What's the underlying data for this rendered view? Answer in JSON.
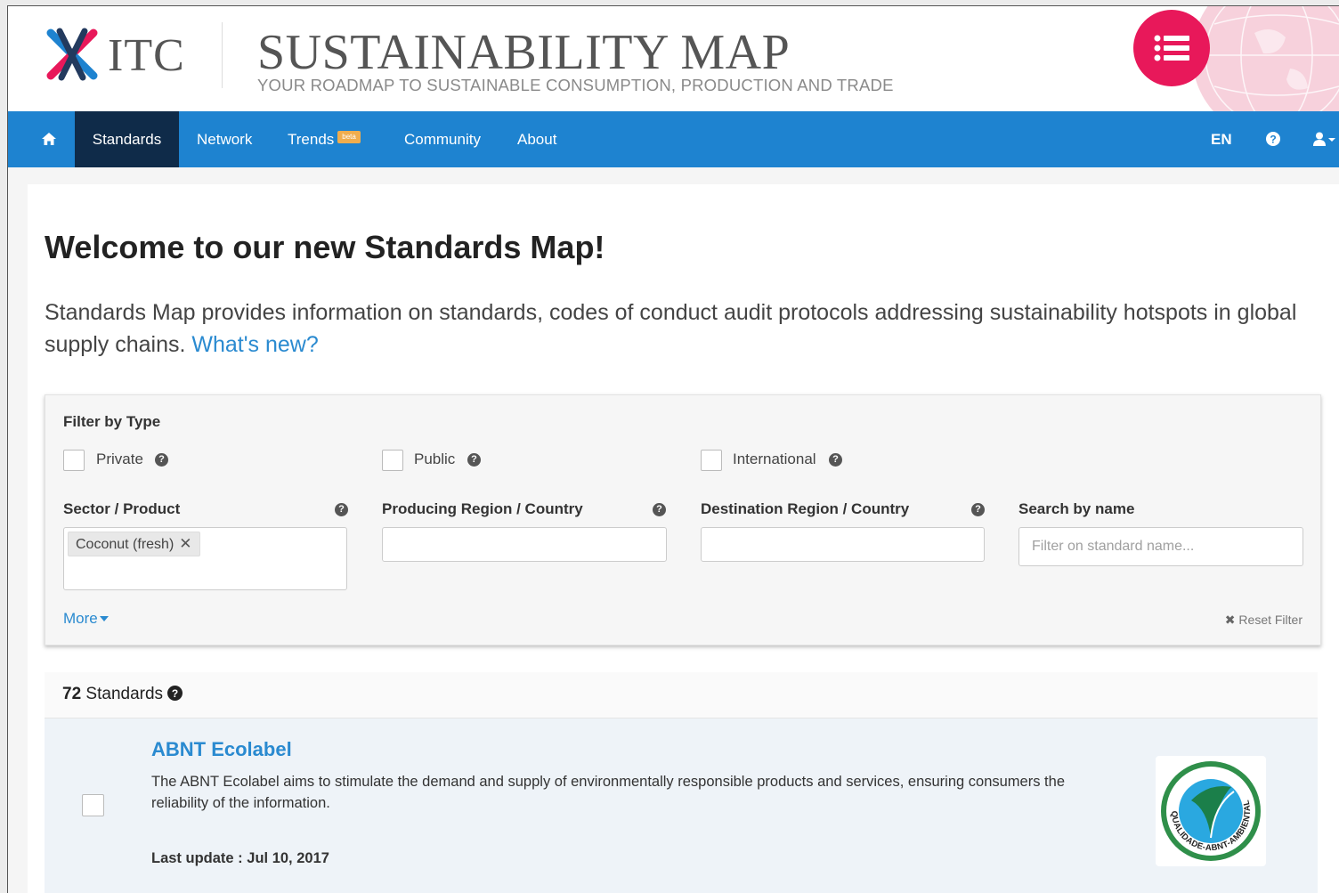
{
  "header": {
    "logo_text": "ITC",
    "title": "SUSTAINABILITY MAP",
    "tagline": "YOUR ROADMAP TO SUSTAINABLE CONSUMPTION, PRODUCTION AND TRADE",
    "menu_icon": "list-icon",
    "colors": {
      "accent": "#e8185a",
      "nav": "#1e83d0",
      "nav_active": "#0f2b49"
    }
  },
  "nav": {
    "home_icon": "home-icon",
    "items": [
      {
        "label": "Standards"
      },
      {
        "label": "Network"
      },
      {
        "label": "Trends",
        "badge": "beta"
      },
      {
        "label": "Community"
      },
      {
        "label": "About"
      }
    ],
    "language": "EN",
    "help_icon": "question-circle-icon",
    "user_icon": "user-icon"
  },
  "main": {
    "welcome": "Welcome to our new Standards Map!",
    "intro": "Standards Map provides information on standards, codes of conduct audit protocols addressing sustainability hotspots in global supply chains.",
    "whats_new": "What's new?"
  },
  "filter": {
    "type_label": "Filter by Type",
    "types": [
      {
        "label": "Private",
        "checked": false
      },
      {
        "label": "Public",
        "checked": false
      },
      {
        "label": "International",
        "checked": false
      }
    ],
    "sector_label": "Sector / Product",
    "sector_tag": "Coconut (fresh)",
    "producing_label": "Producing Region / Country",
    "destination_label": "Destination Region / Country",
    "search_label": "Search by name",
    "search_placeholder": "Filter on standard name...",
    "more_label": "More",
    "reset_label": "Reset Filter"
  },
  "results": {
    "count": "72",
    "count_label": "Standards",
    "items": [
      {
        "title": "ABNT Ecolabel",
        "description": "The ABNT Ecolabel aims to stimulate the demand and supply of environmentally responsible products and services, ensuring consumers the reliability of the information.",
        "last_update_label": "Last update :",
        "last_update": "Jul 10, 2017",
        "logo_text": "QUALIDADE-ABNT-AMBIENTAL"
      }
    ]
  }
}
